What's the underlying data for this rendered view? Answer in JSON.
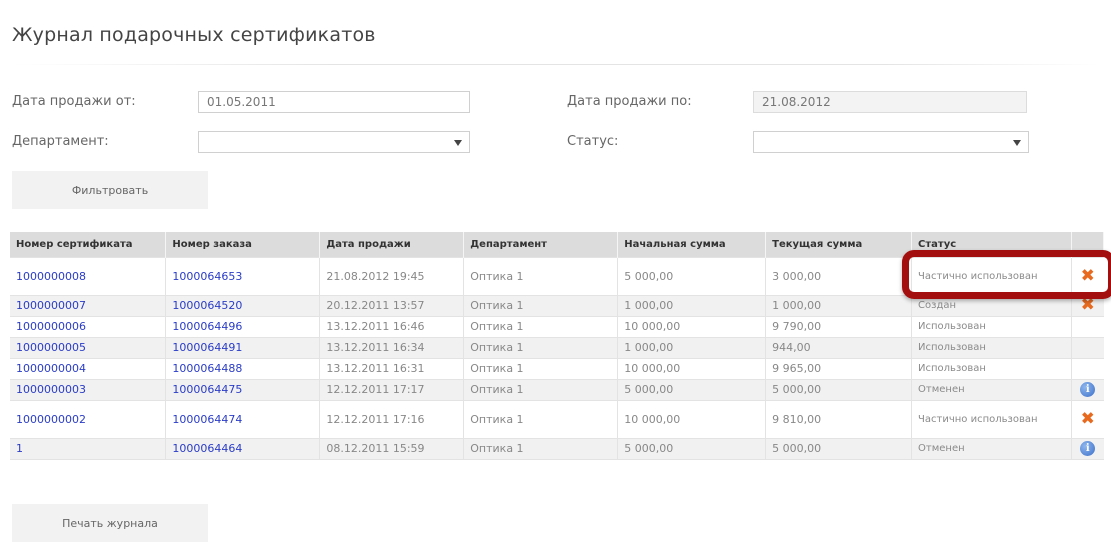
{
  "page": {
    "title": "Журнал подарочных сертификатов"
  },
  "filters": {
    "date_from_label": "Дата продажи от:",
    "date_from_value": "01.05.2011",
    "date_to_label": "Дата продажи по:",
    "date_to_value": "21.08.2012",
    "department_label": "Департамент:",
    "department_value": "",
    "status_label": "Статус:",
    "status_value": "",
    "filter_button": "Фильтровать"
  },
  "table": {
    "columns": [
      "Номер сертификата",
      "Номер заказа",
      "Дата продажи",
      "Департамент",
      "Начальная сумма",
      "Текущая сумма",
      "Статус"
    ],
    "rows": [
      {
        "cert": "1000000008",
        "order": "1000064653",
        "date": "21.08.2012 19:45",
        "dept": "Оптика 1",
        "initial": "5 000,00",
        "current": "3 000,00",
        "status": "Частично использован",
        "action": "cancel-icon"
      },
      {
        "cert": "1000000007",
        "order": "1000064520",
        "date": "20.12.2011 13:57",
        "dept": "Оптика 1",
        "initial": "1 000,00",
        "current": "1 000,00",
        "status": "Создан",
        "action": "cancel-icon"
      },
      {
        "cert": "1000000006",
        "order": "1000064496",
        "date": "13.12.2011 16:46",
        "dept": "Оптика 1",
        "initial": "10 000,00",
        "current": "9 790,00",
        "status": "Использован",
        "action": ""
      },
      {
        "cert": "1000000005",
        "order": "1000064491",
        "date": "13.12.2011 16:34",
        "dept": "Оптика 1",
        "initial": "1 000,00",
        "current": "944,00",
        "status": "Использован",
        "action": ""
      },
      {
        "cert": "1000000004",
        "order": "1000064488",
        "date": "13.12.2011 16:31",
        "dept": "Оптика 1",
        "initial": "10 000,00",
        "current": "9 965,00",
        "status": "Использован",
        "action": ""
      },
      {
        "cert": "1000000003",
        "order": "1000064475",
        "date": "12.12.2011 17:17",
        "dept": "Оптика 1",
        "initial": "5 000,00",
        "current": "5 000,00",
        "status": "Отменен",
        "action": "info-icon"
      },
      {
        "cert": "1000000002",
        "order": "1000064474",
        "date": "12.12.2011 17:16",
        "dept": "Оптика 1",
        "initial": "10 000,00",
        "current": "9 810,00",
        "status": "Частично использован",
        "action": "cancel-icon"
      },
      {
        "cert": "1",
        "order": "1000064464",
        "date": "08.12.2011 15:59",
        "dept": "Оптика 1",
        "initial": "5 000,00",
        "current": "5 000,00",
        "status": "Отменен",
        "action": "info-icon"
      }
    ]
  },
  "print_button": "Печать журнала",
  "colors": {
    "link": "#2a3cc7",
    "cancel_icon": "#e76a1f",
    "highlight_border": "#a30f0f"
  }
}
